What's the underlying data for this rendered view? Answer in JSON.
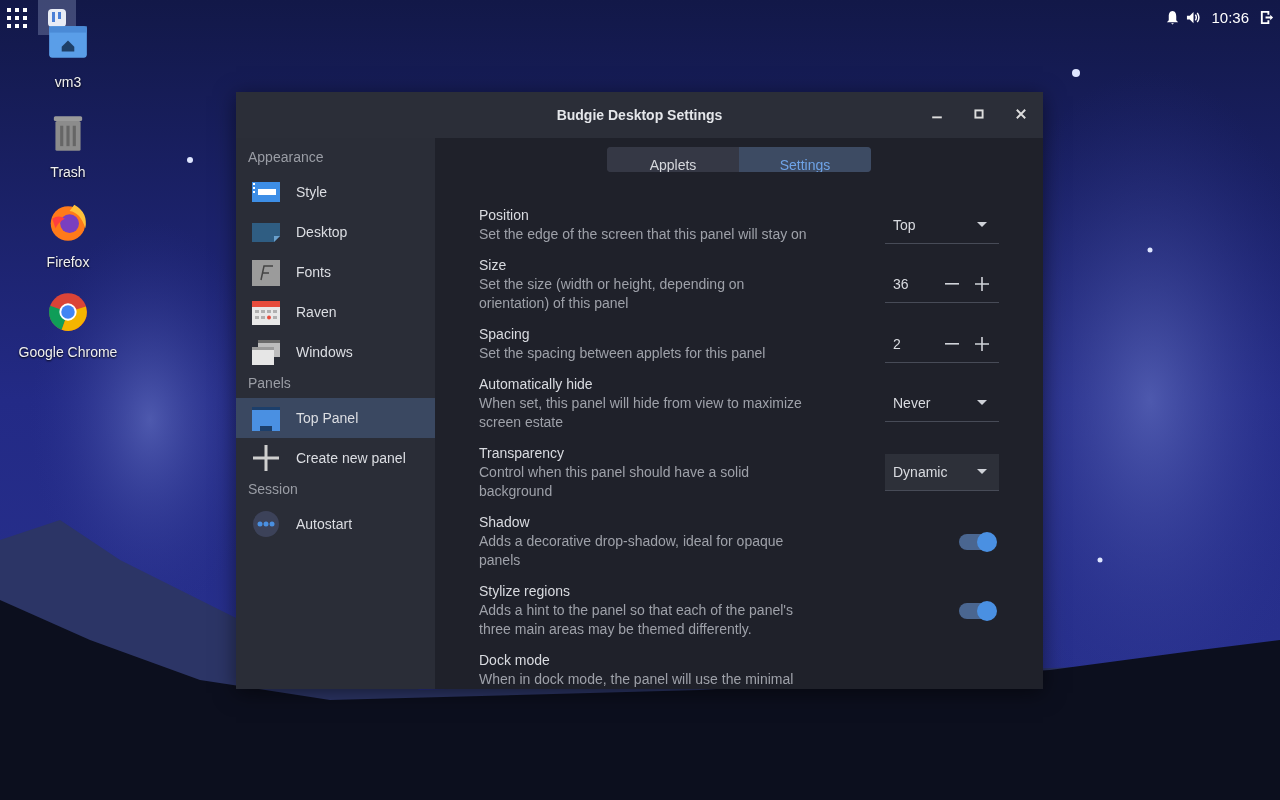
{
  "top_bar": {
    "clock": "10:36"
  },
  "desktop_icons": [
    {
      "label": "vm3"
    },
    {
      "label": "Trash"
    },
    {
      "label": "Firefox"
    },
    {
      "label": "Google Chrome"
    }
  ],
  "window": {
    "title": "Budgie Desktop Settings"
  },
  "sidebar": {
    "sections": [
      {
        "heading": "Appearance",
        "items": [
          {
            "label": "Style",
            "selected": false
          },
          {
            "label": "Desktop",
            "selected": false
          },
          {
            "label": "Fonts",
            "selected": false
          },
          {
            "label": "Raven",
            "selected": false
          },
          {
            "label": "Windows",
            "selected": false
          }
        ]
      },
      {
        "heading": "Panels",
        "items": [
          {
            "label": "Top Panel",
            "selected": true
          },
          {
            "label": "Create new panel",
            "selected": false
          }
        ]
      },
      {
        "heading": "Session",
        "items": [
          {
            "label": "Autostart",
            "selected": false
          }
        ]
      }
    ]
  },
  "tabs": [
    {
      "label": "Applets",
      "selected": false
    },
    {
      "label": "Settings",
      "selected": true
    }
  ],
  "settings": [
    {
      "title": "Position",
      "description": "Set the edge of the screen that this panel will stay on",
      "kind": "dropdown",
      "value": "Top",
      "hovered": false
    },
    {
      "title": "Size",
      "description": "Set the size (width or height, depending on orientation) of this panel",
      "kind": "spin",
      "value": "36"
    },
    {
      "title": "Spacing",
      "description": "Set the spacing between applets for this panel",
      "kind": "spin",
      "value": "2"
    },
    {
      "title": "Automatically hide",
      "description": "When set, this panel will hide from view to maximize screen estate",
      "kind": "dropdown",
      "value": "Never",
      "hovered": false
    },
    {
      "title": "Transparency",
      "description": "Control when this panel should have a solid background",
      "kind": "dropdown",
      "value": "Dynamic",
      "hovered": true
    },
    {
      "title": "Shadow",
      "description": "Adds a decorative drop-shadow, ideal for opaque panels",
      "kind": "switch",
      "on": true
    },
    {
      "title": "Stylize regions",
      "description": "Adds a hint to the panel so that each of the panel's three main areas may be themed differently.",
      "kind": "switch",
      "on": true
    },
    {
      "title": "Dock mode",
      "description": "When in dock mode, the panel will use the minimal"
    }
  ]
}
